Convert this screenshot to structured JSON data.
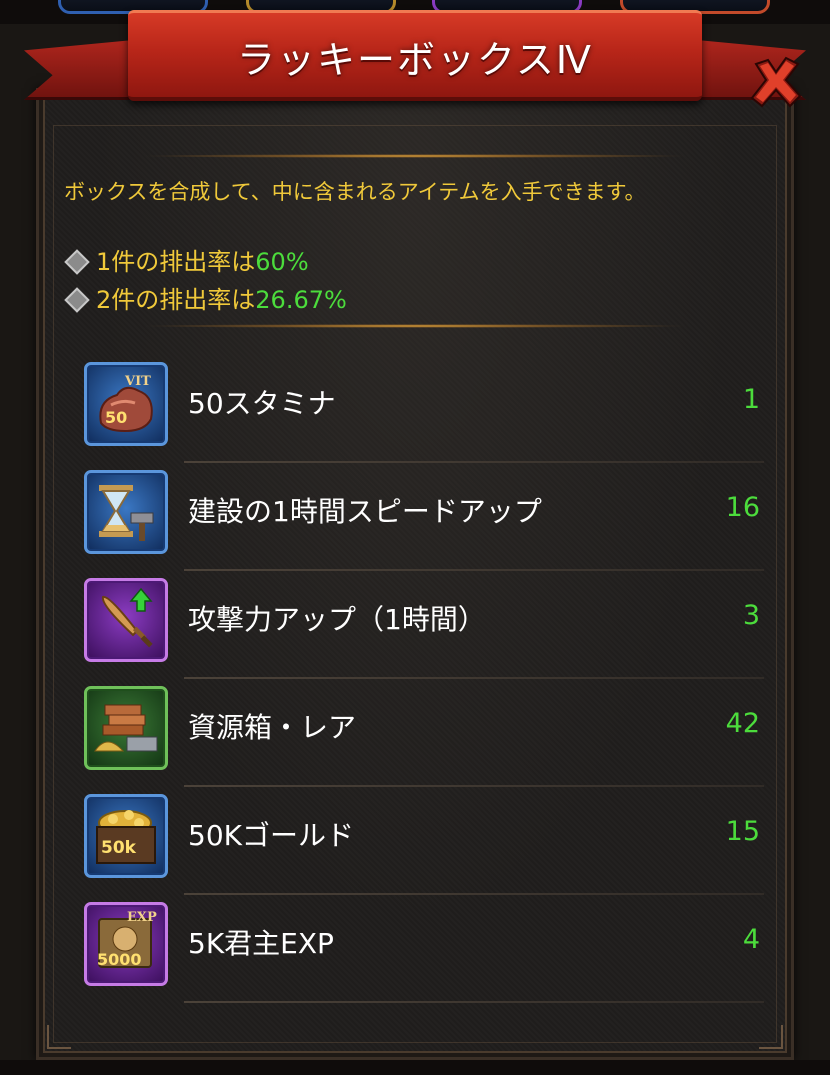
{
  "dialog": {
    "title": "ラッキーボックスⅣ",
    "description": "ボックスを合成して、中に含まれるアイテムを入手できます。",
    "rates": [
      {
        "prefix": "1件の排出率は",
        "value": "60%"
      },
      {
        "prefix": "2件の排出率は",
        "value": "26.67%"
      }
    ]
  },
  "items": [
    {
      "name": "50スタミナ",
      "count": "1",
      "icon": "stamina-icon",
      "badge": "50",
      "tag": "VIT",
      "frame_color": "#5b96dc"
    },
    {
      "name": "建設の1時間スピードアップ",
      "count": "16",
      "icon": "hourglass-icon",
      "frame_color": "#5b96dc"
    },
    {
      "name": "攻撃力アップ（1時間）",
      "count": "3",
      "icon": "sword-icon",
      "frame_color": "#c67be6"
    },
    {
      "name": "資源箱・レア",
      "count": "42",
      "icon": "resource-box-icon",
      "frame_color": "#6fc15a"
    },
    {
      "name": "50Kゴールド",
      "count": "15",
      "icon": "gold-chest-icon",
      "badge": "50k",
      "frame_color": "#5b96dc"
    },
    {
      "name": "5K君主EXP",
      "count": "4",
      "icon": "exp-book-icon",
      "badge": "5000",
      "tag": "EXP",
      "frame_color": "#c67be6"
    }
  ],
  "colors": {
    "banner": "#b82619",
    "description_text": "#f0c93a",
    "highlight_value": "#4cdc3c",
    "item_name": "#ffffff"
  }
}
